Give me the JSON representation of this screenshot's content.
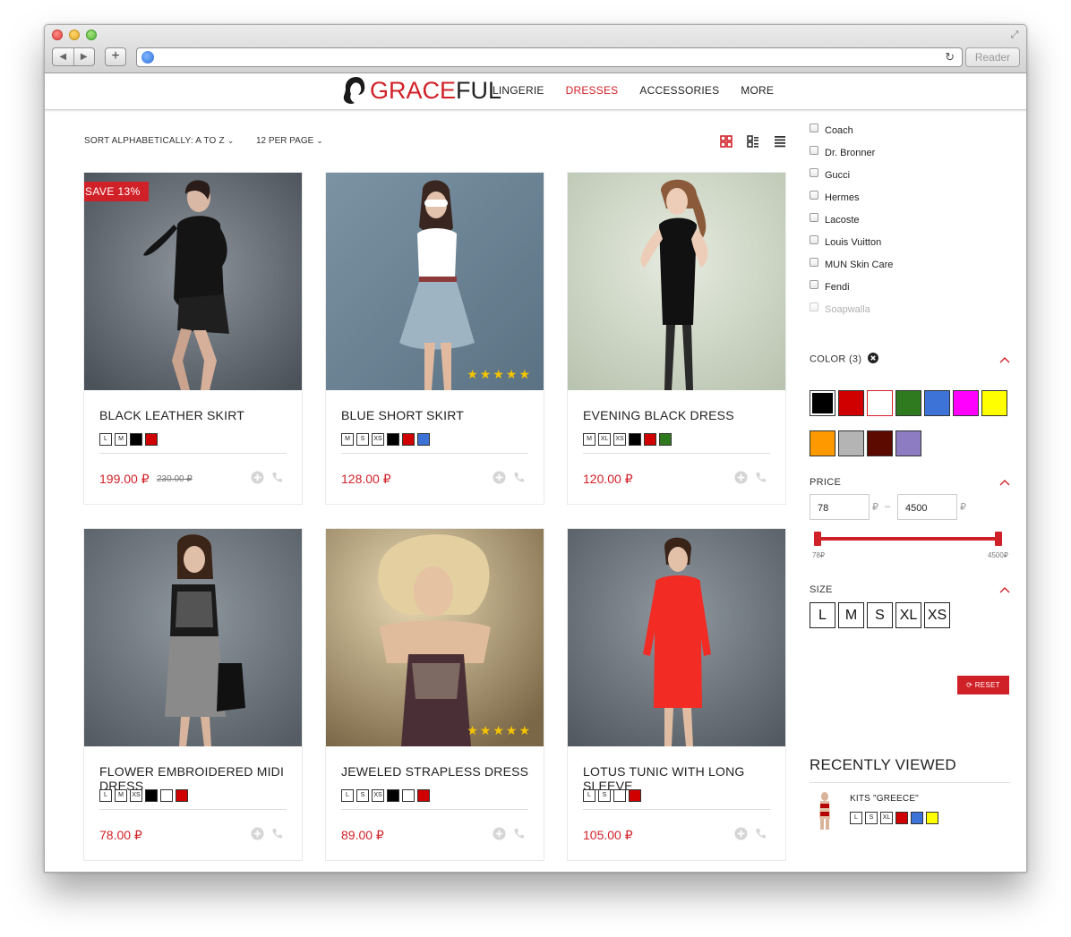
{
  "browser": {
    "reader_label": "Reader",
    "nav_back": "◀",
    "nav_forward": "▶",
    "add_tab": "+"
  },
  "header": {
    "logo_part1": "GRACE",
    "logo_part2": "FUL",
    "nav": [
      "LINGERIE",
      "DRESSES",
      "ACCESSORIES",
      "MORE"
    ],
    "active_nav": "DRESSES"
  },
  "toolbar": {
    "sort_label": "SORT ALPHABETICALLY: A TO Z",
    "per_page_label": "12 PER PAGE"
  },
  "products": [
    {
      "title": "BLACK LEATHER SKIRT",
      "price": "199.00 ₽",
      "old_price": "230.00 ₽",
      "badge": "SAVE 13%",
      "sizes": [
        "L",
        "M"
      ],
      "colors": [
        "#000000",
        "#d10000"
      ],
      "stars": ""
    },
    {
      "title": "BLUE SHORT SKIRT",
      "price": "128.00 ₽",
      "old_price": "",
      "badge": "",
      "sizes": [
        "M",
        "S",
        "XS"
      ],
      "colors": [
        "#000000",
        "#d10000",
        "#3d73d6"
      ],
      "stars": "★★★★★"
    },
    {
      "title": "EVENING BLACK DRESS",
      "price": "120.00 ₽",
      "old_price": "",
      "badge": "",
      "sizes": [
        "M",
        "XL",
        "XS"
      ],
      "colors": [
        "#000000",
        "#d10000",
        "#2f7a1f"
      ],
      "stars": ""
    },
    {
      "title": "FLOWER EMBROIDERED MIDI DRESS",
      "price": "78.00 ₽",
      "old_price": "",
      "badge": "",
      "sizes": [
        "L",
        "M",
        "XS"
      ],
      "colors": [
        "#000000",
        "#ffffff",
        "#d10000"
      ],
      "stars": ""
    },
    {
      "title": "JEWELED STRAPLESS DRESS",
      "price": "89.00 ₽",
      "old_price": "",
      "badge": "",
      "sizes": [
        "L",
        "S",
        "XS"
      ],
      "colors": [
        "#000000",
        "#ffffff",
        "#d10000"
      ],
      "stars": "★★★★★"
    },
    {
      "title": "LOTUS TUNIC WITH LONG SLEEVE",
      "price": "105.00 ₽",
      "old_price": "",
      "badge": "",
      "sizes": [
        "L",
        "S"
      ],
      "colors": [
        "#ffffff",
        "#d10000"
      ],
      "stars": ""
    }
  ],
  "sidebar": {
    "brands": [
      "Coach",
      "Dr. Bronner",
      "Gucci",
      "Hermes",
      "Lacoste",
      "Louis Vuitton",
      "MUN Skin Care",
      "Fendi",
      "Soapwalla"
    ],
    "color_title": "COLOR (3)",
    "color_swatches": [
      "#000000",
      "#d10000",
      "#ffffff",
      "#2f7a1f",
      "#3d73d6",
      "#ff00ff",
      "#ffff00",
      "#ff9900",
      "#b4b4b4",
      "#5c0a00",
      "#8e7cc3"
    ],
    "price_title": "PRICE",
    "price_min": "78",
    "price_max": "4500",
    "currency": "₽",
    "dash": "–",
    "range_min_label": "78₽",
    "range_max_label": "4500₽",
    "size_title": "SIZE",
    "sizes": [
      "L",
      "M",
      "S",
      "XL",
      "XS"
    ],
    "reset_label": "RESET",
    "recently_viewed_title": "RECENTLY VIEWED",
    "recent_item": {
      "name": "KITS \"GREECE\"",
      "sizes": [
        "L",
        "S",
        "XL"
      ],
      "colors": [
        "#d10000",
        "#3d73d6",
        "#ffff00"
      ]
    }
  }
}
